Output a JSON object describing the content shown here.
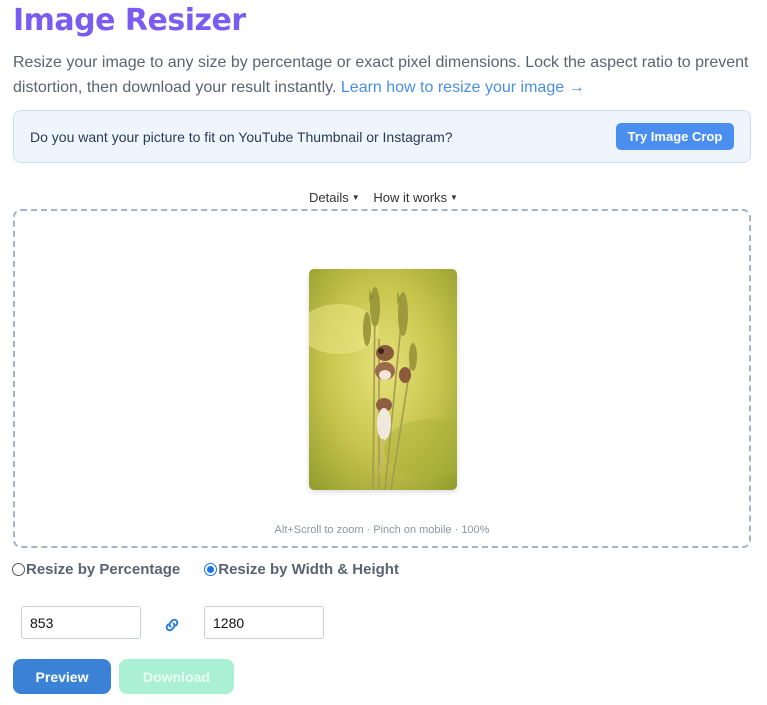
{
  "header": {
    "title": "Image Resizer",
    "description": "Resize your image to any size by percentage or exact pixel dimensions. Lock the aspect ratio to prevent distortion, then download your result instantly.",
    "learn_link": "Learn how to resize your image →"
  },
  "banner": {
    "text": "Do you want your picture to fit on YouTube Thumbnail or Instagram?",
    "button_label": "Try Image Crop"
  },
  "toggles": {
    "details_label": "Details",
    "how_label": "How it works"
  },
  "dropzone": {
    "zoom_hint": "Alt+Scroll to zoom · Pinch on mobile · 100%",
    "image_subject": "harvest mice climbing wheat stalks"
  },
  "mode": {
    "percentage_label": "Resize by Percentage",
    "width_height_label": "Resize by Width & Height",
    "selected": "width_height"
  },
  "dimensions": {
    "width": "853",
    "height": "1280",
    "link_icon": "link-icon"
  },
  "actions": {
    "preview_label": "Preview",
    "download_label": "Download",
    "download_enabled": false
  },
  "colors": {
    "title": "#7b5cf0",
    "accent": "#4a8ff0",
    "preview_button": "#3b82d6",
    "download_button_disabled": "#aaf0d4"
  }
}
